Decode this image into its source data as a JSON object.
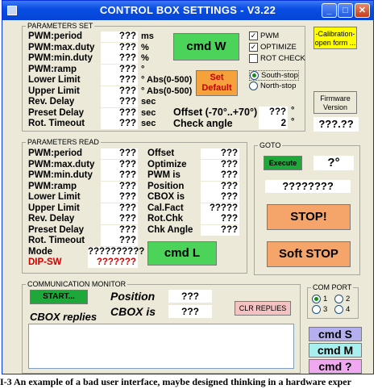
{
  "window": {
    "title": "CONTROL BOX SETTINGS - V3.22",
    "minimize": "_",
    "maximize": "□",
    "close": "✕"
  },
  "params_set": {
    "legend": "PARAMETERS SET",
    "rows": [
      {
        "label": "PWM:period",
        "value": "???",
        "unit": "ms"
      },
      {
        "label": "PWM:max.duty",
        "value": "???",
        "unit": "%"
      },
      {
        "label": "PWM:min.duty",
        "value": "???",
        "unit": "%"
      },
      {
        "label": "PWM:ramp",
        "value": "???",
        "unit": "°"
      },
      {
        "label": "Lower Limit",
        "value": "???",
        "unit": "° Abs(0-500)"
      },
      {
        "label": "Upper Limit",
        "value": "???",
        "unit": "° Abs(0-500)"
      },
      {
        "label": "Rev. Delay",
        "value": "???",
        "unit": "sec"
      },
      {
        "label": "Preset Delay",
        "value": "???",
        "unit": "sec"
      },
      {
        "label": "Rot. Timeout",
        "value": "???",
        "unit": "sec"
      }
    ],
    "cmd_w": "cmd W",
    "set_default": "Set Default",
    "checkboxes": [
      {
        "label": "PWM",
        "checked": true
      },
      {
        "label": "OPTIMIZE",
        "checked": true
      },
      {
        "label": "ROT CHECK",
        "checked": false
      }
    ],
    "radios": [
      {
        "label": "South-stop",
        "selected": true
      },
      {
        "label": "North-stop",
        "selected": false
      }
    ],
    "offset_label": "Offset (-70°..+70°)",
    "offset_value": "???",
    "offset_unit": "°",
    "check_angle_label": "Check angle",
    "check_angle_value": "2",
    "check_angle_unit": "°"
  },
  "calibration_button": "-Calibration-\nopen form ...",
  "firmware_button": "Firmware\nVersion",
  "firmware_value": "???.??",
  "params_read": {
    "legend": "PARAMETERS READ",
    "left_rows": [
      {
        "label": "PWM:period",
        "value": "???"
      },
      {
        "label": "PWM:max.duty",
        "value": "???"
      },
      {
        "label": "PWM:min.duty",
        "value": "???"
      },
      {
        "label": "PWM:ramp",
        "value": "???"
      },
      {
        "label": "Lower Limit",
        "value": "???"
      },
      {
        "label": "Upper Limit",
        "value": "???"
      },
      {
        "label": "Rev. Delay",
        "value": "???"
      },
      {
        "label": "Preset Delay",
        "value": "???"
      },
      {
        "label": "Rot. Timeout",
        "value": "???"
      },
      {
        "label": "Mode",
        "value": "??????????"
      },
      {
        "label": "DIP-SW",
        "value": "???????"
      }
    ],
    "right_rows": [
      {
        "label": "Offset",
        "value": "???"
      },
      {
        "label": "Optimize",
        "value": "???"
      },
      {
        "label": "PWM is",
        "value": "???"
      },
      {
        "label": "Position",
        "value": "???"
      },
      {
        "label": "CBOX is",
        "value": "???"
      },
      {
        "label": "Cal.Fact",
        "value": "?????"
      },
      {
        "label": "Rot.Chk",
        "value": "???"
      },
      {
        "label": "Chk Angle",
        "value": "???"
      }
    ],
    "cmd_l": "cmd L"
  },
  "goto": {
    "legend": "GOTO",
    "execute": "Execute",
    "angle_value": "?°",
    "status_value": "????????",
    "stop": "STOP!",
    "soft_stop": "Soft STOP"
  },
  "comm": {
    "legend": "COMMUNICATION MONITOR",
    "start": "START...",
    "position_label": "Position",
    "position_value": "???",
    "cbox_label": "CBOX is",
    "cbox_value": "???",
    "clr_replies": "CLR REPLIES",
    "cbox_replies": "CBOX replies",
    "replies_text": ""
  },
  "com_port": {
    "legend": "COM PORT",
    "options": [
      {
        "label": "1",
        "selected": true
      },
      {
        "label": "2",
        "selected": false
      },
      {
        "label": "3",
        "selected": false
      },
      {
        "label": "4",
        "selected": false
      }
    ]
  },
  "cmd_buttons": {
    "s": "cmd S",
    "m": "cmd M",
    "q": "cmd ?"
  },
  "caption": "I-3 An example of a bad user interface, maybe designed thinking in a hardware exper"
}
